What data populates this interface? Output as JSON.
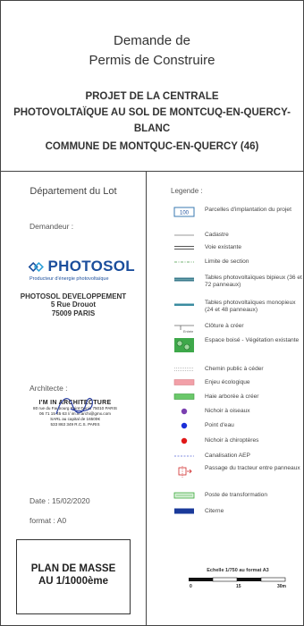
{
  "header": {
    "title1": "Demande de",
    "title2": "Permis de Construire",
    "project": [
      "PROJET  DE LA CENTRALE",
      "PHOTOVOLTAÏQUE AU SOL DE MONTCUQ-EN-QUERCY-",
      "BLANC",
      "COMMUNE DE MONTQUC-EN-QUERCY (46)"
    ]
  },
  "left": {
    "department": "Département du Lot",
    "demandeur_label": "Demandeur :",
    "logo": {
      "name": "PHOTOSOL",
      "tagline": "Producteur d'énergie photovoltaïque"
    },
    "company": [
      "PHOTOSOL DEVELOPPEMENT",
      "5 Rue Drouot",
      "75009 PARIS"
    ],
    "architecte_label": "Architecte :",
    "stamp": {
      "title": "I'M IN ARCHITECTURE",
      "lines": [
        "80 rue du Faubourg Saint Denis 75010 PARIS",
        "06 71 15 45 63 // im.in.archi@gmx.com",
        "SARL au capital de 16500€",
        "533 863 349 R.C.S. PARIS"
      ]
    },
    "date": "Date : 15/02/2020",
    "format": "format : A0",
    "plan_title": [
      "PLAN DE MASSE",
      "AU 1/1000ème"
    ]
  },
  "legend": {
    "title": "Legende :",
    "items": [
      {
        "label": "Parcelles d'implantation du projet",
        "symbol_text": "100",
        "icon": "parcel-box"
      },
      {
        "label": "Cadastre",
        "icon": "thin-line"
      },
      {
        "label": "Voie existante",
        "icon": "double-line"
      },
      {
        "label": "Limite de section",
        "icon": "dash-dot-line"
      },
      {
        "label": "Tables photovoltaïques bipieux (36 et 72 panneaux)",
        "icon": "pv-bipieux"
      },
      {
        "label": "Tables photovoltaïques monopieux (24 et 48 panneaux)",
        "icon": "pv-monopieux"
      },
      {
        "label": "Clôture à créer",
        "symbol_text": "Entrée",
        "icon": "fence"
      },
      {
        "label": "Espace boisé - Végétation existante",
        "icon": "wood"
      },
      {
        "label": "Chemin public à céder",
        "icon": "dotted-path"
      },
      {
        "label": "Enjeu écologique",
        "icon": "pink-rect"
      },
      {
        "label": "Haie arborée à créer",
        "icon": "green-rect"
      },
      {
        "label": "Nichoir à oiseaux",
        "icon": "purple-dot"
      },
      {
        "label": "Point d'eau",
        "icon": "blue-dot"
      },
      {
        "label": "Nichoir à chiroptères",
        "icon": "red-dot"
      },
      {
        "label": "Canalisation AEP",
        "icon": "dashed-blue-line"
      },
      {
        "label": "Passage du tracteur entre panneaux",
        "icon": "tractor"
      },
      {
        "label": "Poste de transformation",
        "icon": "transformer"
      },
      {
        "label": "Citerne",
        "icon": "cistern"
      }
    ],
    "colors": {
      "photosol_blue": "#1b4e9c",
      "pv_teal": "#3a7a8c",
      "green": "#2e9e3e",
      "pink": "#f2a0a8",
      "purple": "#7a3fb0",
      "blue_dot": "#1b2fd8",
      "red": "#e01818",
      "cistern": "#1a3a9a"
    }
  },
  "scale": {
    "title": "Echelle 1/750 au format A3",
    "ticks": [
      "0",
      "15",
      "30m"
    ]
  }
}
